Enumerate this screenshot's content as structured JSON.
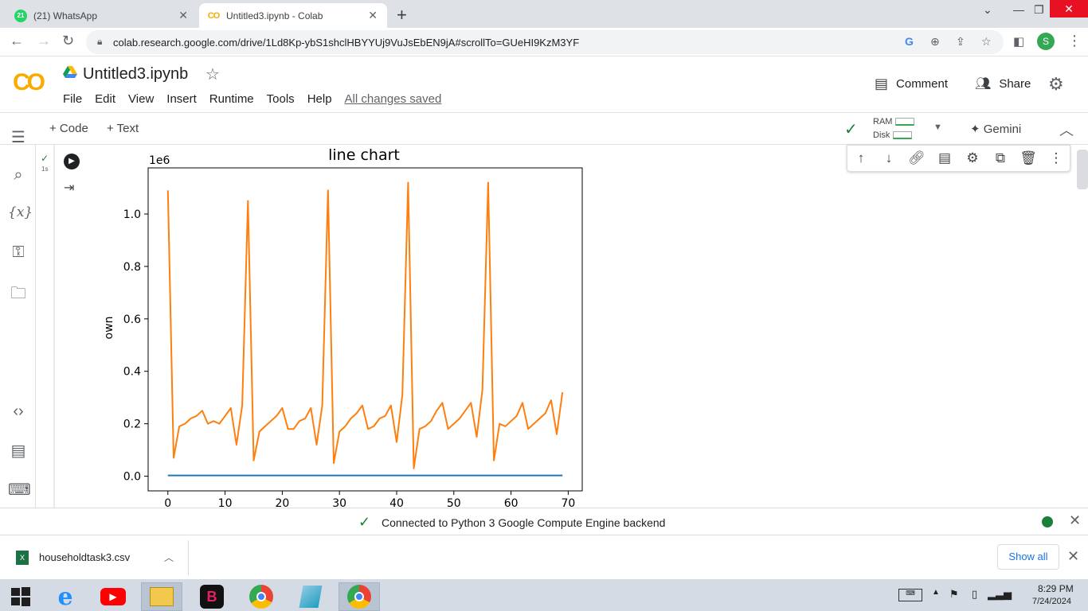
{
  "browser": {
    "tabs": [
      {
        "label": "(21) WhatsApp",
        "badge": "21",
        "active": false
      },
      {
        "label": "Untitled3.ipynb - Colab",
        "badge": "CO",
        "active": true
      }
    ],
    "url": "colab.research.google.com/drive/1Ld8Kp-ybS1shclHBYYUj9VuJsEbEN9jA#scrollTo=GUeHI9KzM3YF",
    "profile_initial": "S"
  },
  "colab": {
    "logo": "CO",
    "notebook_title": "Untitled3.ipynb",
    "menu": [
      "File",
      "Edit",
      "View",
      "Insert",
      "Runtime",
      "Tools",
      "Help"
    ],
    "saved_status": "All changes saved",
    "comment_label": "Comment",
    "share_label": "Share",
    "add_code_label": "+ Code",
    "add_text_label": "+ Text",
    "ram_label": "RAM",
    "disk_label": "Disk",
    "gemini_label": "Gemini",
    "cell_run_time": "1s",
    "status_text": "Connected to Python 3 Google Compute Engine backend"
  },
  "download": {
    "filename": "householdtask3.csv",
    "show_all_label": "Show all"
  },
  "taskbar": {
    "time": "8:29 PM",
    "date": "7/24/2024"
  },
  "colors": {
    "series_blue": "#1f77b4",
    "series_orange": "#ff7f0e",
    "colab_orange": "#f9ab00",
    "status_green": "#188038"
  },
  "chart_data": {
    "type": "line",
    "title": "line chart",
    "xlabel": "",
    "ylabel": "own",
    "y_scale_label": "1e6",
    "xlim": [
      -3.45,
      72.45
    ],
    "ylim": [
      -0.056,
      1.176
    ],
    "xticks": [
      0,
      10,
      20,
      30,
      40,
      50,
      60,
      70
    ],
    "yticks": [
      0.0,
      0.2,
      0.4,
      0.6,
      0.8,
      1.0
    ],
    "ytick_labels": [
      "0.0",
      "0.2",
      "0.4",
      "0.6",
      "0.8",
      "1.0"
    ],
    "series": [
      {
        "x": [
          0,
          69
        ],
        "values": [
          0.003,
          0.003
        ]
      },
      {
        "x": [
          0,
          1,
          2,
          3,
          4,
          5,
          6,
          7,
          8,
          9,
          10,
          11,
          12,
          13,
          14,
          15,
          16,
          17,
          18,
          19,
          20,
          21,
          22,
          23,
          24,
          25,
          26,
          27,
          28,
          29,
          30,
          31,
          32,
          33,
          34,
          35,
          36,
          37,
          38,
          39,
          40,
          41,
          42,
          43,
          44,
          45,
          46,
          47,
          48,
          49,
          50,
          51,
          52,
          53,
          54,
          55,
          56,
          57,
          58,
          59,
          60,
          61,
          62,
          63,
          64,
          65,
          66,
          67,
          68,
          69
        ],
        "values": [
          1.09,
          0.07,
          0.19,
          0.2,
          0.22,
          0.23,
          0.25,
          0.2,
          0.21,
          0.2,
          0.23,
          0.26,
          0.12,
          0.27,
          1.05,
          0.06,
          0.17,
          0.19,
          0.21,
          0.23,
          0.26,
          0.18,
          0.18,
          0.21,
          0.22,
          0.26,
          0.12,
          0.27,
          1.09,
          0.05,
          0.17,
          0.19,
          0.22,
          0.24,
          0.27,
          0.18,
          0.19,
          0.22,
          0.23,
          0.27,
          0.13,
          0.31,
          1.12,
          0.03,
          0.18,
          0.19,
          0.21,
          0.25,
          0.28,
          0.18,
          0.2,
          0.22,
          0.25,
          0.28,
          0.15,
          0.33,
          1.12,
          0.06,
          0.2,
          0.19,
          0.21,
          0.23,
          0.28,
          0.18,
          0.2,
          0.22,
          0.24,
          0.29,
          0.16,
          0.32
        ]
      }
    ],
    "grid": false
  }
}
